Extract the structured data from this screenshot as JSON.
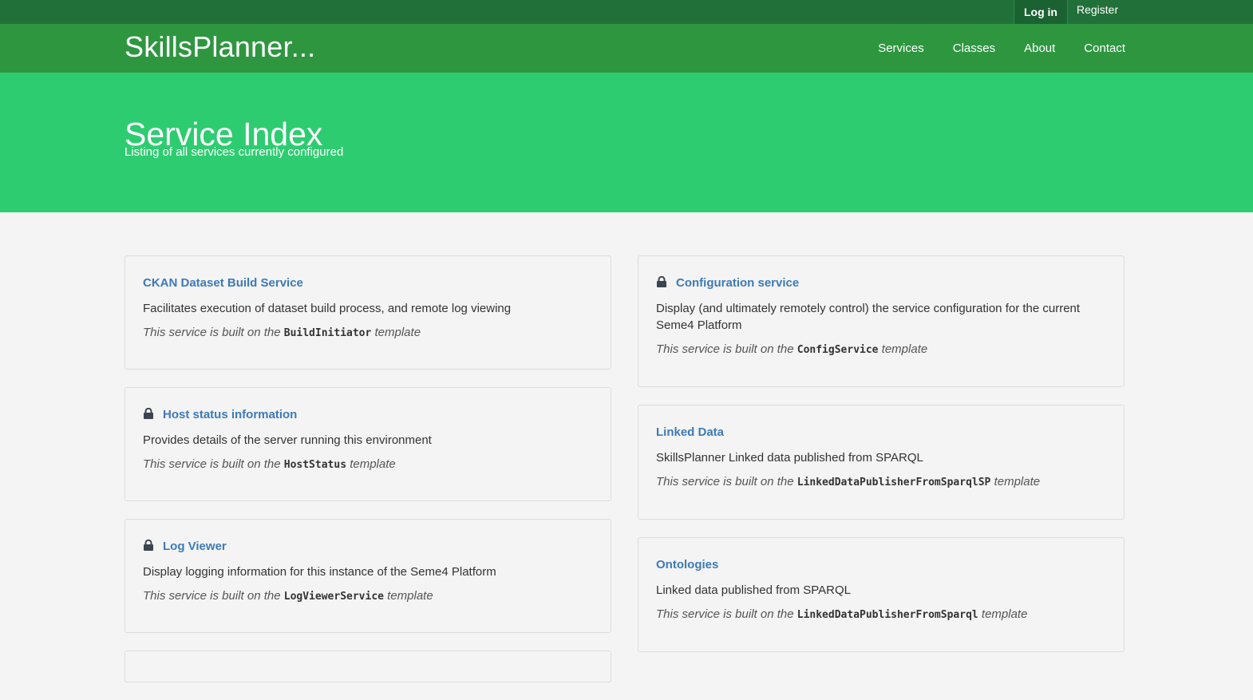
{
  "topbar": {
    "login_label": "Log in",
    "register_label": "Register"
  },
  "navbar": {
    "brand": "SkillsPlanner...",
    "links": [
      "Services",
      "Classes",
      "About",
      "Contact"
    ]
  },
  "hero": {
    "title": "Service Index",
    "subtitle": "Listing of all services currently configured"
  },
  "template_prefix": "This service is built on the",
  "template_suffix": "template",
  "colors": {
    "topbar": "#21703a",
    "navbar": "#2f9640",
    "hero": "#2ecc71",
    "link": "#3d7ab8"
  },
  "services_left": [
    {
      "title": "CKAN Dataset Build Service",
      "locked": false,
      "description": "Facilitates execution of dataset build process, and remote log viewing",
      "template": "BuildInitiator"
    },
    {
      "title": "Host status information",
      "locked": true,
      "description": "Provides details of the server running this environment",
      "template": "HostStatus"
    },
    {
      "title": "Log Viewer",
      "locked": true,
      "description": "Display logging information for this instance of the Seme4 Platform",
      "template": "LogViewerService"
    }
  ],
  "services_right": [
    {
      "title": "Configuration service",
      "locked": true,
      "description": "Display (and ultimately remotely control) the service configuration for the current Seme4 Platform",
      "template": "ConfigService"
    },
    {
      "title": "Linked Data",
      "locked": false,
      "description": "SkillsPlanner Linked data published from SPARQL",
      "template": "LinkedDataPublisherFromSparqlSP"
    },
    {
      "title": "Ontologies",
      "locked": false,
      "description": "Linked data published from SPARQL",
      "template": "LinkedDataPublisherFromSparql"
    }
  ]
}
